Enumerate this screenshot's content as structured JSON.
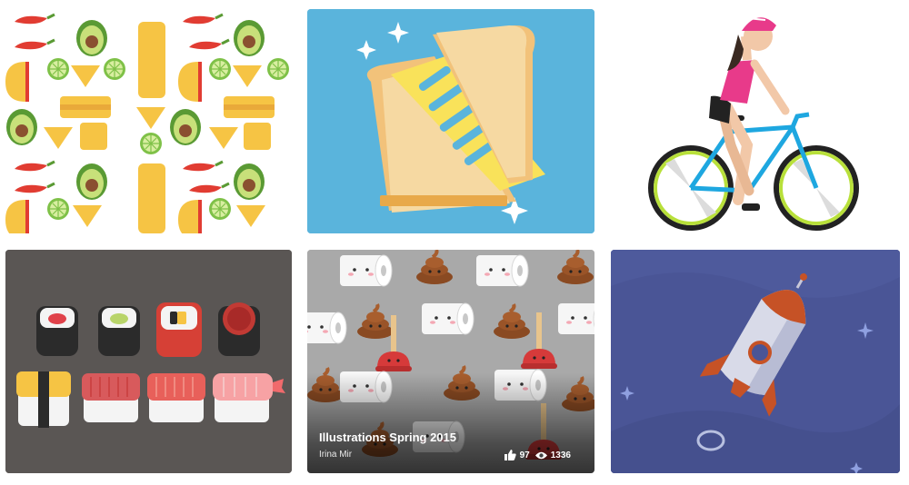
{
  "projects": [
    {
      "subject": "taco-burrito-avocado-pattern"
    },
    {
      "subject": "grilled-cheese-sandwich"
    },
    {
      "subject": "cyclist-girl"
    },
    {
      "subject": "sushi-set"
    },
    {
      "subject": "toilet-paper-poop-plunger-pattern",
      "title": "Illustrations Spring 2015",
      "owner": "Irina Mir",
      "appreciations": "97",
      "views": "1336"
    },
    {
      "subject": "rocket-in-space"
    }
  ],
  "colors": {
    "sky_blue": "#5ab4dc",
    "sushi_bg": "#5a5654",
    "pattern_gray": "#a9a9a9",
    "space_blue": "#4a5596"
  }
}
